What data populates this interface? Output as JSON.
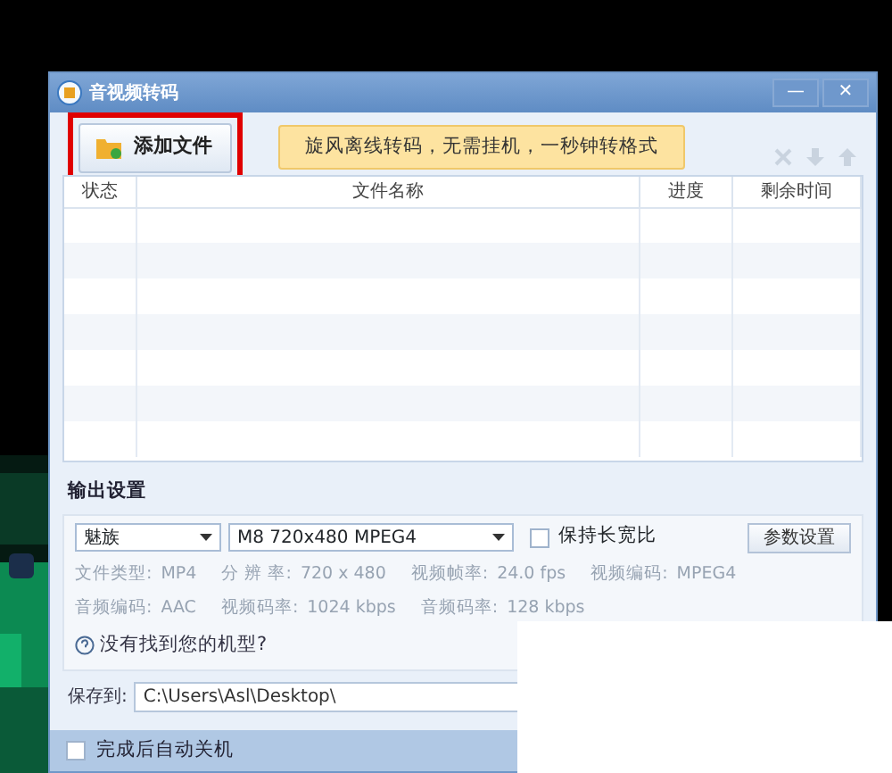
{
  "window": {
    "title": "音视频转码",
    "controls": [
      "—",
      "✕"
    ]
  },
  "toolbar": {
    "add_button": {
      "label": "添加文件",
      "highlighted": true
    },
    "banner": "旋风离线转码，无需挂机，一秒钟转格式",
    "actions": [
      {
        "kind": "delete",
        "disabled": true
      },
      {
        "kind": "down",
        "disabled": true
      },
      {
        "kind": "up",
        "disabled": true
      }
    ]
  },
  "table": {
    "columns": [
      "状态",
      "文件名称",
      "进度",
      "剩余时间"
    ]
  },
  "output": {
    "title": "输出设置",
    "brand": "魅族",
    "model": "M8 720x480 MPEG4",
    "keep_ratio": {
      "label": "保持长宽比",
      "checked": false
    },
    "params_button": "参数设置",
    "info": [
      [
        {
          "label": "文件类型:",
          "value": "MP4"
        },
        {
          "label": "分 辨 率:",
          "value": "720 x 480"
        },
        {
          "label": "视频帧率:",
          "value": "24.0 fps"
        },
        {
          "label": "视频编码:",
          "value": "MPEG4"
        }
      ],
      [
        {
          "label": "音频编码:",
          "value": "AAC"
        },
        {
          "label": "视频码率:",
          "value": "1024 kbps"
        },
        {
          "label": "音频码率:",
          "value": "128 kbps"
        }
      ]
    ],
    "help_link": "没有找到您的机型?"
  },
  "save": {
    "label": "保存到:",
    "value": "C:\\Users\\Asl\\Desktop\\"
  },
  "footer": {
    "shutdown": {
      "label": "完成后自动关机",
      "checked": false
    }
  }
}
